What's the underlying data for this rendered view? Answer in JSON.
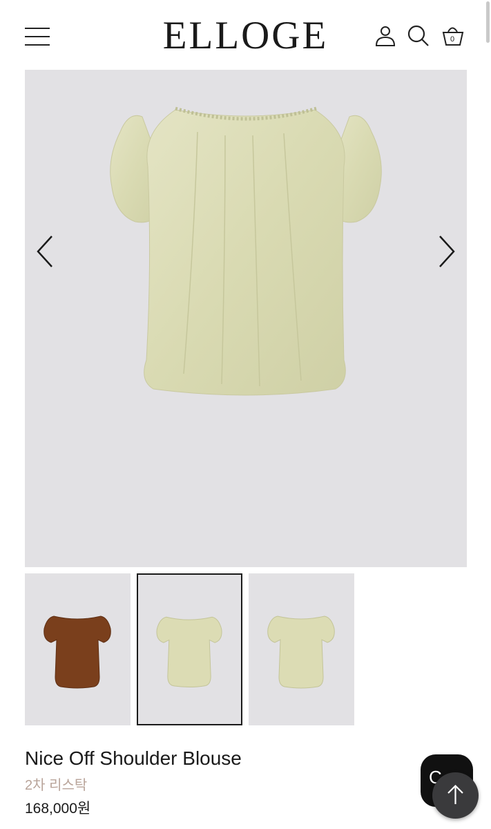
{
  "header": {
    "logo": "ELLOGE",
    "menu_icon": "hamburger-menu-icon",
    "account_icon": "user-icon",
    "search_icon": "search-icon",
    "cart_icon": "basket-icon",
    "cart_count": "0"
  },
  "gallery": {
    "main_image": "olive-off-shoulder-blouse-photo",
    "prev_icon": "chevron-left-icon",
    "next_icon": "chevron-right-icon",
    "thumbnails": [
      {
        "image": "brown-blouse-thumbnail",
        "color": "#7a3f1c",
        "selected": false
      },
      {
        "image": "olive-blouse-thumbnail",
        "color": "#dcdcb4",
        "selected": true
      },
      {
        "image": "olive-blouse-thumbnail",
        "color": "#dcdcb4",
        "selected": false
      }
    ]
  },
  "product": {
    "name": "Nice Off Shoulder Blouse",
    "note": "2차 리스탁",
    "price": "168,000원"
  },
  "floating": {
    "chat_label": "C",
    "top_icon": "arrow-up-icon"
  },
  "colors": {
    "image_bg": "#e2e1e4",
    "blouse_olive": "#dcdcb4",
    "blouse_brown": "#7a3f1c",
    "note_text": "#b9a49a"
  }
}
